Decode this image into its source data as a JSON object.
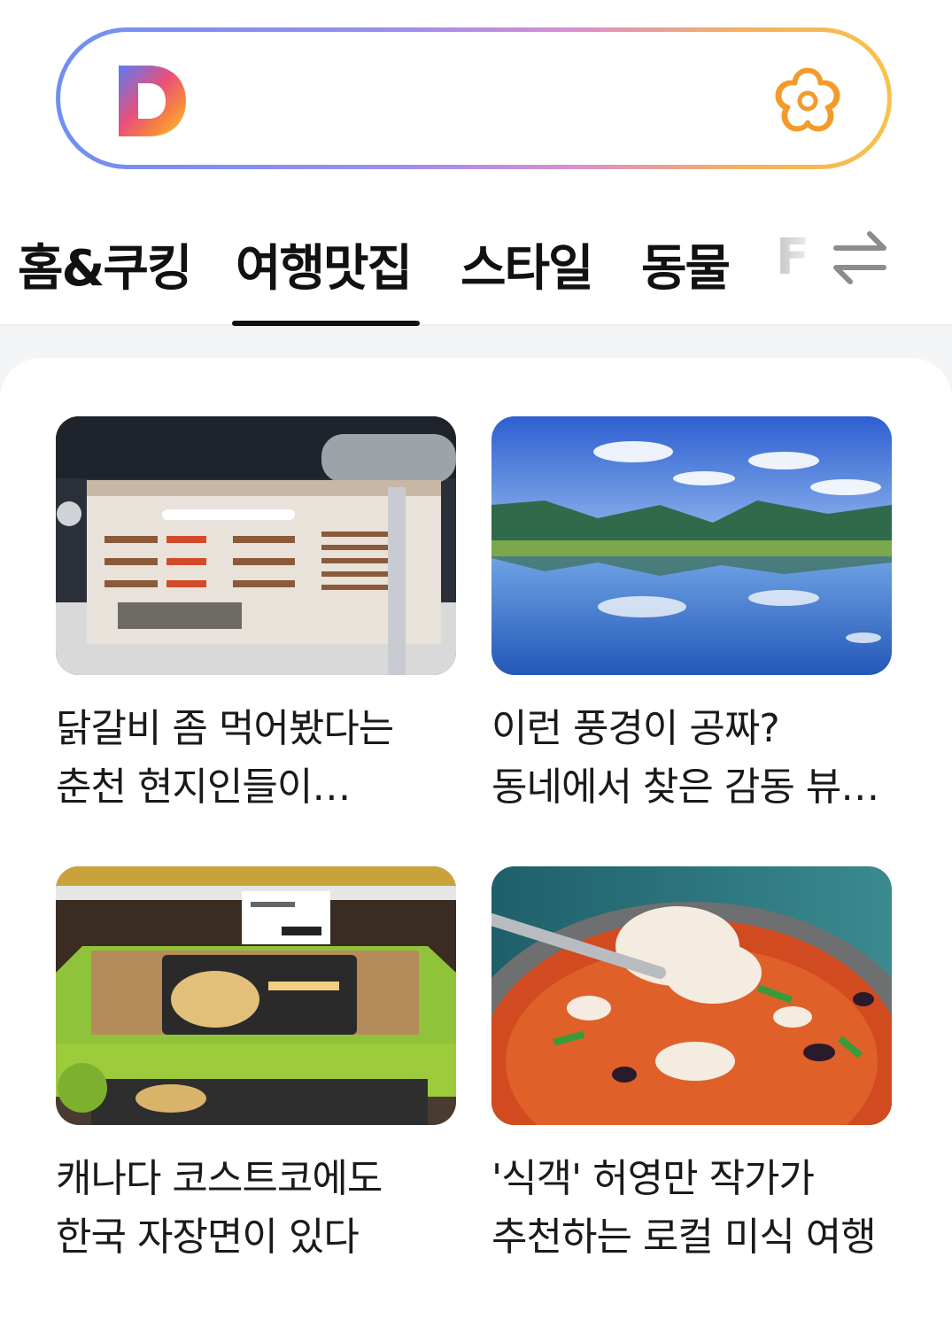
{
  "search": {
    "logo_letter": "D"
  },
  "tabs": [
    {
      "label": "홈&쿠킹",
      "active": false
    },
    {
      "label": "여행맛집",
      "active": true
    },
    {
      "label": "스타일",
      "active": false
    },
    {
      "label": "동물",
      "active": false
    },
    {
      "label": "F",
      "active": false
    }
  ],
  "icons": {
    "logo": "daum-logo-icon",
    "flower": "flower-icon",
    "swap": "swap-arrows-icon"
  },
  "colors": {
    "gradient_start": "#6f8ff0",
    "gradient_end": "#f7c24a",
    "flower_orange": "#f39b2a",
    "background_gray": "#f3f4f6"
  },
  "articles": [
    {
      "title": "닭갈비 좀 먹어봤다는 춘천 현지인들이 방문하는 닭갈비 맛집",
      "image": "dakgalbi-menu-board"
    },
    {
      "title": "이런 풍경이 공짜? 동네에서 찾은 감동 뷰 여행지",
      "image": "lake-mountain-landscape"
    },
    {
      "title": "캐나다 코스트코에도 한국 자장면이 있다",
      "image": "costco-jajangmyeon-package"
    },
    {
      "title": "'식객' 허영만 작가가 추천하는 로컬 미식 여행",
      "image": "tofu-stew-bowl"
    }
  ]
}
